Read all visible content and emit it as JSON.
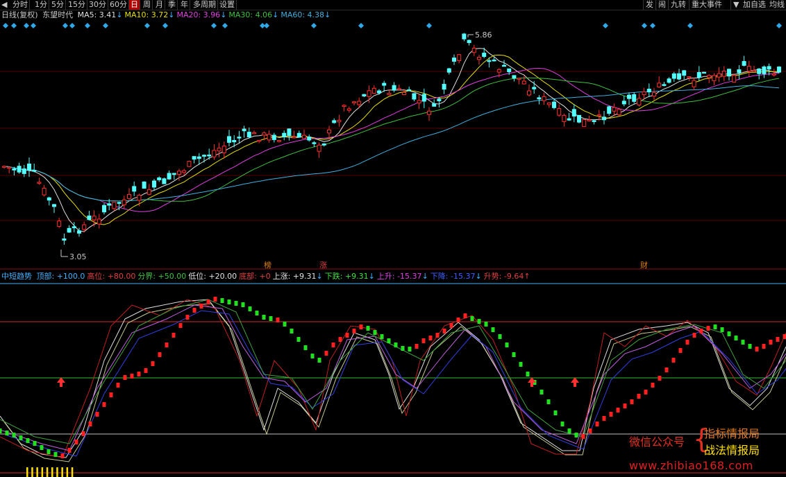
{
  "toolbar": {
    "back_label": "◀",
    "periods": [
      "分时",
      "1分",
      "5分",
      "15分",
      "30分",
      "60分",
      "日",
      "周",
      "月",
      "季",
      "年",
      "多周期",
      "设置"
    ],
    "active_period": "日",
    "right_buttons": [
      "发",
      "闹",
      "九转",
      "重大事件",
      "▼",
      "加自选",
      "均线"
    ]
  },
  "main_legend": {
    "label": "日线(复权)",
    "stock_name": "东望时代",
    "ma": [
      {
        "text": "MA5: 3.41",
        "arrow": "↓",
        "color": "#e0e0e0"
      },
      {
        "text": "MA10: 3.72",
        "arrow": "↓",
        "color": "#e8e000"
      },
      {
        "text": "MA20: 3.96",
        "arrow": "↓",
        "color": "#e040e0"
      },
      {
        "text": "MA30: 4.06",
        "arrow": "↓",
        "color": "#40c040"
      },
      {
        "text": "MA60: 4.38",
        "arrow": "↓",
        "color": "#40b0e0"
      }
    ]
  },
  "price_annotations": {
    "high": "5.86",
    "low": "3.05",
    "markers": [
      {
        "text": "榜",
        "color": "#e08000"
      },
      {
        "text": "涨",
        "color": "#e04040"
      },
      {
        "text": "财",
        "color": "#e08000"
      }
    ]
  },
  "indicator_legend": {
    "name": "中短趋势",
    "items": [
      {
        "text": "顶部: +100.0",
        "color": "#40b0ff"
      },
      {
        "text": "高位: +80.00",
        "color": "#e04040"
      },
      {
        "text": "分界: +50.00",
        "color": "#40c040"
      },
      {
        "text": "低位: +20.00",
        "color": "#e0e0e0"
      },
      {
        "text": "底部: +0",
        "color": "#e04040"
      },
      {
        "text": "上涨: +9.31",
        "arrow": "↓",
        "color": "#e0e0e0"
      },
      {
        "text": "下跌: +9.31",
        "arrow": "↓",
        "color": "#40e040"
      },
      {
        "text": "上升: -15.37",
        "arrow": "↓",
        "color": "#e040e0"
      },
      {
        "text": "下降: -15.37",
        "arrow": "↓",
        "color": "#4060ff"
      },
      {
        "text": "升势: -9.64",
        "arrow": "↑",
        "color": "#e04040"
      }
    ]
  },
  "watermark": {
    "label": "微信公众号",
    "brace": "{",
    "line1": "指标情报局",
    "line2": "战法情报局",
    "url": "www.zhibiao168.com"
  },
  "colors": {
    "up_candle": "#ff3030",
    "down_candle": "#54ffff",
    "ma5": "#e0e0e0",
    "ma10": "#e8e000",
    "ma20": "#e040e0",
    "ma30": "#40c040",
    "ma60": "#40b0e0",
    "osc_red": "#ff2020",
    "osc_green": "#20e020"
  }
}
